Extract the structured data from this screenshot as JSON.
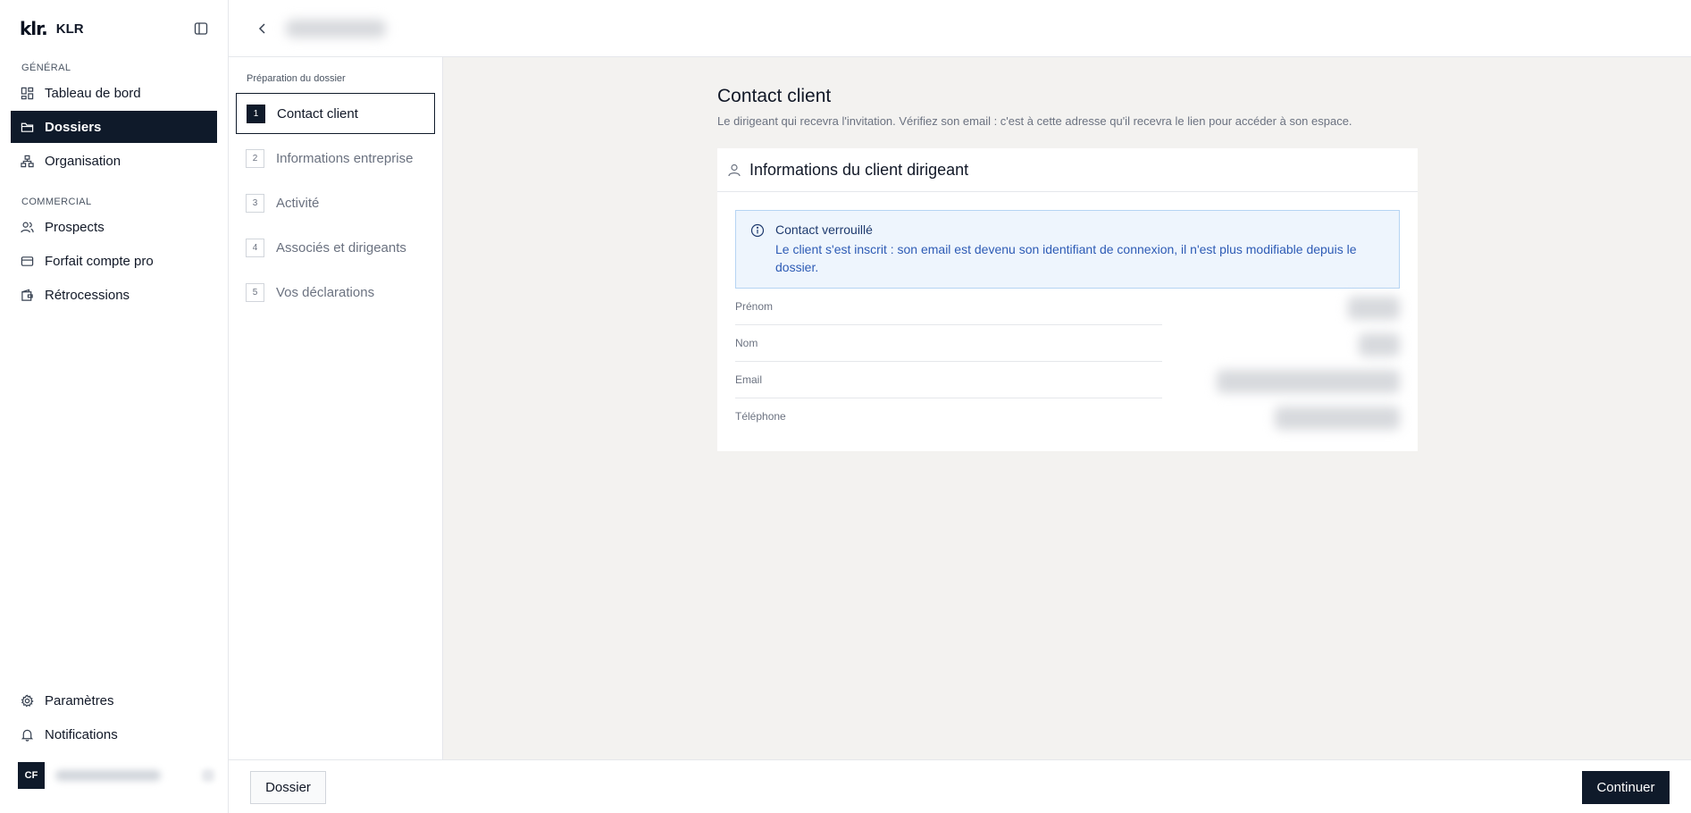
{
  "app": {
    "logo_text": "klr.",
    "name": "KLR"
  },
  "sidebar": {
    "sections": [
      {
        "label": "GÉNÉRAL"
      },
      {
        "label": "COMMERCIAL"
      }
    ],
    "items": [
      {
        "label": "Tableau de bord",
        "icon": "dashboard-icon"
      },
      {
        "label": "Dossiers",
        "icon": "folder-icon",
        "active": true
      },
      {
        "label": "Organisation",
        "icon": "org-icon"
      },
      {
        "label": "Prospects",
        "icon": "users-icon"
      },
      {
        "label": "Forfait compte pro",
        "icon": "card-icon"
      },
      {
        "label": "Rétrocessions",
        "icon": "wallet-icon"
      }
    ],
    "footer_items": [
      {
        "label": "Paramètres",
        "icon": "gear-icon"
      },
      {
        "label": "Notifications",
        "icon": "bell-icon"
      }
    ],
    "user": {
      "initials": "CF"
    }
  },
  "steps": {
    "title": "Préparation du dossier",
    "items": [
      {
        "num": "1",
        "label": "Contact client",
        "active": true
      },
      {
        "num": "2",
        "label": "Informations entreprise"
      },
      {
        "num": "3",
        "label": "Activité"
      },
      {
        "num": "4",
        "label": "Associés et dirigeants"
      },
      {
        "num": "5",
        "label": "Vos déclarations"
      }
    ]
  },
  "main": {
    "title": "Contact client",
    "subtitle": "Le dirigeant qui recevra l'invitation. Vérifiez son email : c'est à cette adresse qu'il recevra le lien pour accéder à son espace.",
    "card": {
      "title": "Informations du client dirigeant",
      "alert": {
        "title": "Contact verrouillé",
        "text": "Le client s'est inscrit : son email est devenu son identifiant de connexion, il n'est plus modifiable depuis le dossier."
      },
      "fields": [
        {
          "label": "Prénom"
        },
        {
          "label": "Nom"
        },
        {
          "label": "Email"
        },
        {
          "label": "Téléphone"
        }
      ]
    }
  },
  "footer": {
    "secondary_label": "Dossier",
    "primary_label": "Continuer"
  },
  "colors": {
    "primary": "#0f1a2a",
    "background": "#f3f2f0",
    "alert_bg": "#eef5fd",
    "alert_text": "#2d5bb5"
  }
}
